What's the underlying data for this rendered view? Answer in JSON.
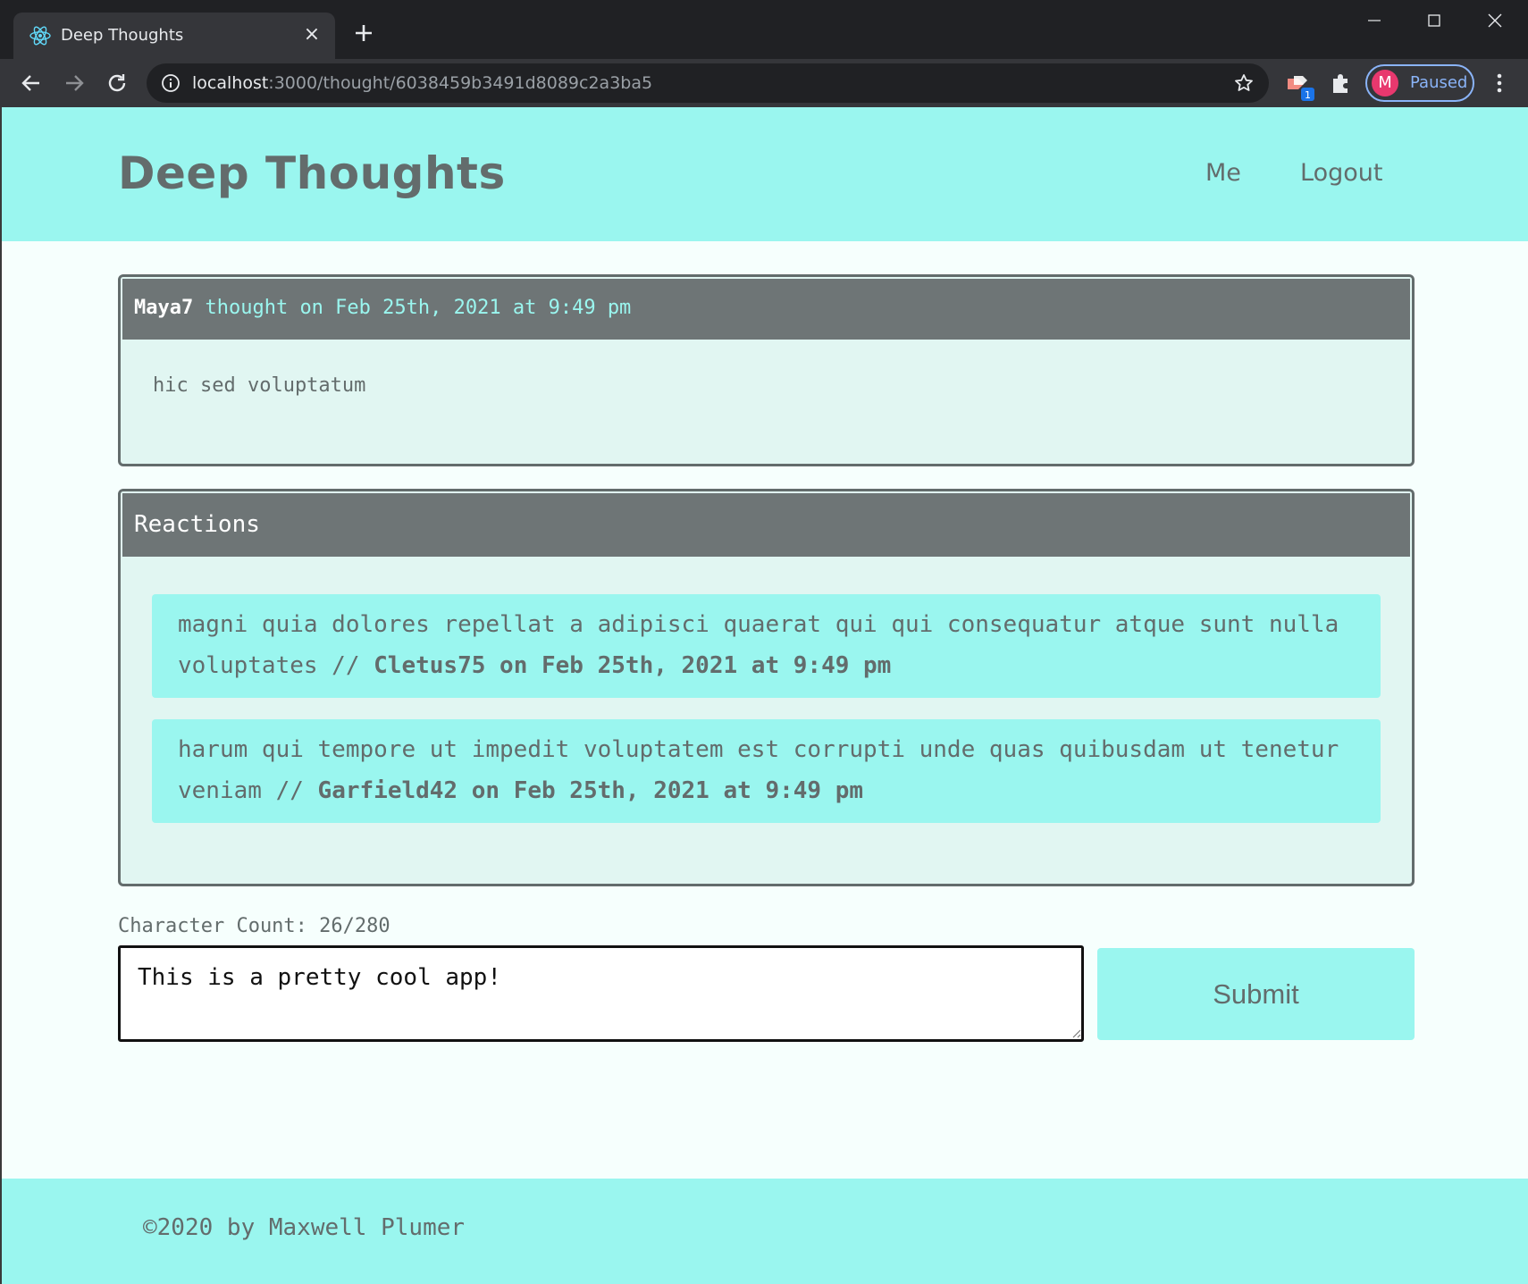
{
  "browser": {
    "tab_title": "Deep Thoughts",
    "tab_close": "×",
    "url_host": "localhost",
    "url_path": ":3000/thought/6038459b3491d8089c2a3ba5",
    "profile_initial": "M",
    "profile_status": "Paused",
    "extension_badge": "1"
  },
  "header": {
    "title": "Deep Thoughts",
    "nav": [
      "Me",
      "Logout"
    ]
  },
  "thought": {
    "username": "Maya7",
    "meta": " thought on Feb 25th, 2021 at 9:49 pm",
    "body": "hic sed voluptatum"
  },
  "reactions": {
    "heading": "Reactions",
    "items": [
      {
        "body": "magni quia dolores repellat a adipisci quaerat qui qui consequatur atque sunt nulla voluptates // ",
        "byline": "Cletus75 on Feb 25th, 2021 at 9:49 pm"
      },
      {
        "body": "harum qui tempore ut impedit voluptatem est corrupti unde quas quibusdam ut tenetur veniam // ",
        "byline": "Garfield42 on Feb 25th, 2021 at 9:49 pm"
      }
    ]
  },
  "form": {
    "char_count": "Character Count: 26/280",
    "input_value": "This is a pretty cool app!",
    "submit_label": "Submit"
  },
  "footer": {
    "text": "©2020 by Maxwell Plumer"
  },
  "colors": {
    "accent": "#9af6ef",
    "text": "#636c6c",
    "card_bg": "#e1f6f2",
    "card_header": "#6e7576"
  }
}
